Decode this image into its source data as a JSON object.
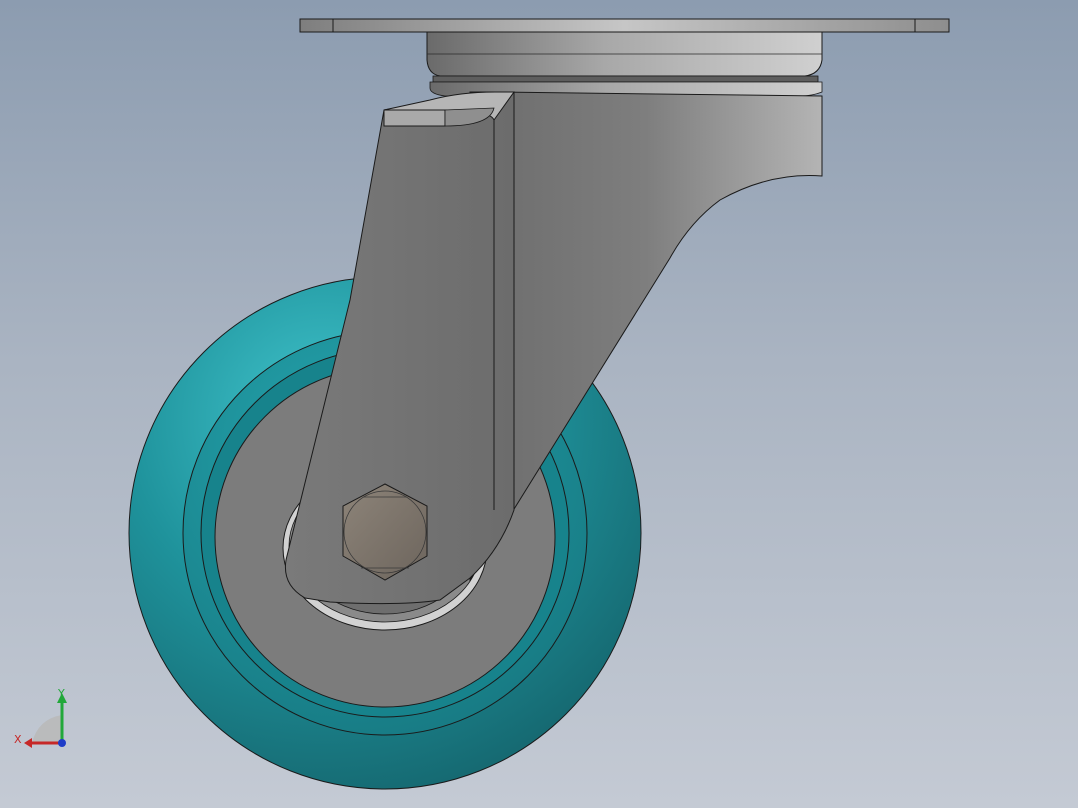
{
  "viewport": {
    "description_colors": {
      "background_top": "#8c9cb0",
      "background_bottom": "#c4cad4",
      "wheel_tread": "#1f8c96",
      "wheel_hub": "#7c7c7c",
      "bracket": "#8a8a8a",
      "plate": "#9a9a9a"
    }
  },
  "triad": {
    "x_label": "X",
    "y_label": "Y",
    "x_color": "#c62828",
    "y_color": "#22a83a",
    "z_color": "#1e3cc8"
  }
}
